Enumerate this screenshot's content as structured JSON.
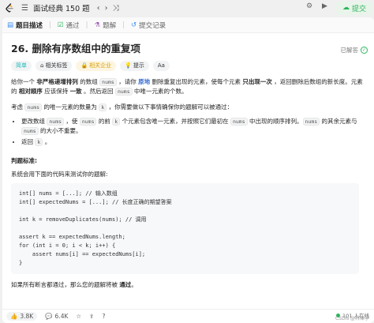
{
  "topbar": {
    "list_icon": "list-icon",
    "title": "面试经典 150 题",
    "submit_label": "提交"
  },
  "tabs": [
    {
      "label": "题目描述",
      "icon": "doc-icon"
    },
    {
      "label": "通过",
      "icon": "check-icon"
    },
    {
      "label": "题解",
      "icon": "book-icon"
    },
    {
      "label": "提交记录",
      "icon": "history-icon"
    }
  ],
  "problem": {
    "title": "26. 删除有序数组中的重复项",
    "status": "已解答",
    "badges": {
      "difficulty": "简单",
      "tags": "相关标签",
      "companies": "相关企业",
      "hint": "提示",
      "font": "Aa"
    },
    "p1": {
      "a": "给你一个 ",
      "b": "非严格递增排列",
      "c": " 的数组 ",
      "code1": "nums",
      "d": " ，请你 ",
      "link": "原地",
      "e": " 删除重复出现的元素，使每个元素 ",
      "f": "只出现一次",
      "g": " ，返回删除后数组的新长度。元素的 ",
      "h": "相对顺序",
      "i": " 应该保持 ",
      "j": "一致",
      "k": " 。然后返回 ",
      "code2": "nums",
      "l": " 中唯一元素的个数。"
    },
    "p2": {
      "a": "考虑 ",
      "code1": "nums",
      "b": " 的唯一元素的数量为 ",
      "code2": "k",
      "c": " ，你需要做以下事情确保你的题解可以被通过："
    },
    "li1": {
      "a": "更改数组 ",
      "code1": "nums",
      "b": " ，使 ",
      "code2": "nums",
      "c": " 的前 ",
      "code3": "k",
      "d": " 个元素包含唯一元素，并按照它们最初在 ",
      "code4": "nums",
      "e": " 中出现的顺序排列。",
      "code5": "nums",
      "f": " 的其余元素与 ",
      "code6": "nums",
      "g": " 的大小不重要。"
    },
    "li2": {
      "a": "返回 ",
      "code1": "k",
      "b": " 。"
    },
    "judge_title": "判题标准:",
    "judge_desc": "系统会用下面的代码来测试你的题解:",
    "code_lines": [
      "int[] nums = [...]; // 输入数组",
      "int[] expectedNums = [...]; // 长度正确的期望答案",
      "",
      "int k = removeDuplicates(nums); // 调用",
      "",
      "assert k == expectedNums.length;",
      "for (int i = 0; i < k; i++) {",
      "    assert nums[i] == expectedNums[i];",
      "}"
    ],
    "last": {
      "a": "如果所有断言都通过，那么您的题解将被 ",
      "b": "通过",
      "c": "。"
    }
  },
  "footer": {
    "likes": "3.8K",
    "comments": "6.4K",
    "online": "101 人在线",
    "watermark": "CSDN @林泽宇",
    "accent_green": "#2db55d",
    "accent_blue": "#3b8ef0"
  }
}
